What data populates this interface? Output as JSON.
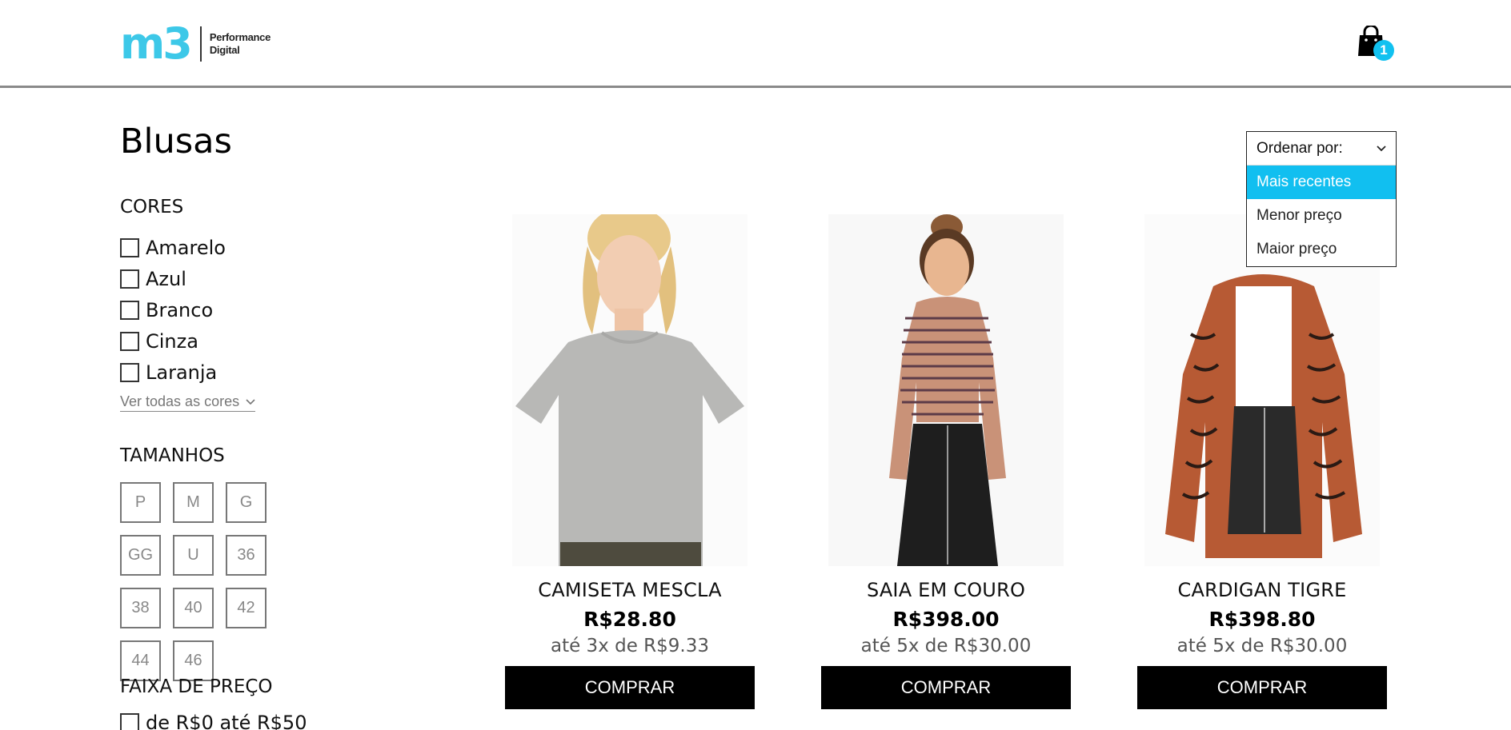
{
  "header": {
    "logo_mark": "m3",
    "logo_text_line1": "Performance",
    "logo_text_line2": "Digital",
    "cart_count": "1",
    "brand_color": "#3dc8e8",
    "badge_color": "#11c1f0"
  },
  "sidebar": {
    "page_title": "Blusas",
    "colors_title": "CORES",
    "colors": [
      "Amarelo",
      "Azul",
      "Branco",
      "Cinza",
      "Laranja"
    ],
    "see_all_colors": "Ver todas as cores",
    "sizes_title": "TAMANHOS",
    "sizes": [
      "P",
      "M",
      "G",
      "GG",
      "U",
      "36",
      "38",
      "40",
      "42",
      "44",
      "46"
    ],
    "price_title": "FAIXA DE PREÇO",
    "price_ranges": [
      "de R$0 até R$50"
    ]
  },
  "sort": {
    "label": "Ordenar por:",
    "options": [
      "Mais recentes",
      "Menor preço",
      "Maior preço"
    ],
    "highlighted": "Mais recentes",
    "highlight_color": "#11bff0"
  },
  "products": [
    {
      "name": "CAMISETA MESCLA",
      "price": "R$28.80",
      "installments": "até 3x de R$9.33",
      "buy_label": "COMPRAR"
    },
    {
      "name": "SAIA EM COURO",
      "price": "R$398.00",
      "installments": "até 5x de R$30.00",
      "buy_label": "COMPRAR"
    },
    {
      "name": "CARDIGAN TIGRE",
      "price": "R$398.80",
      "installments": "até 5x de R$30.00",
      "buy_label": "COMPRAR"
    }
  ]
}
